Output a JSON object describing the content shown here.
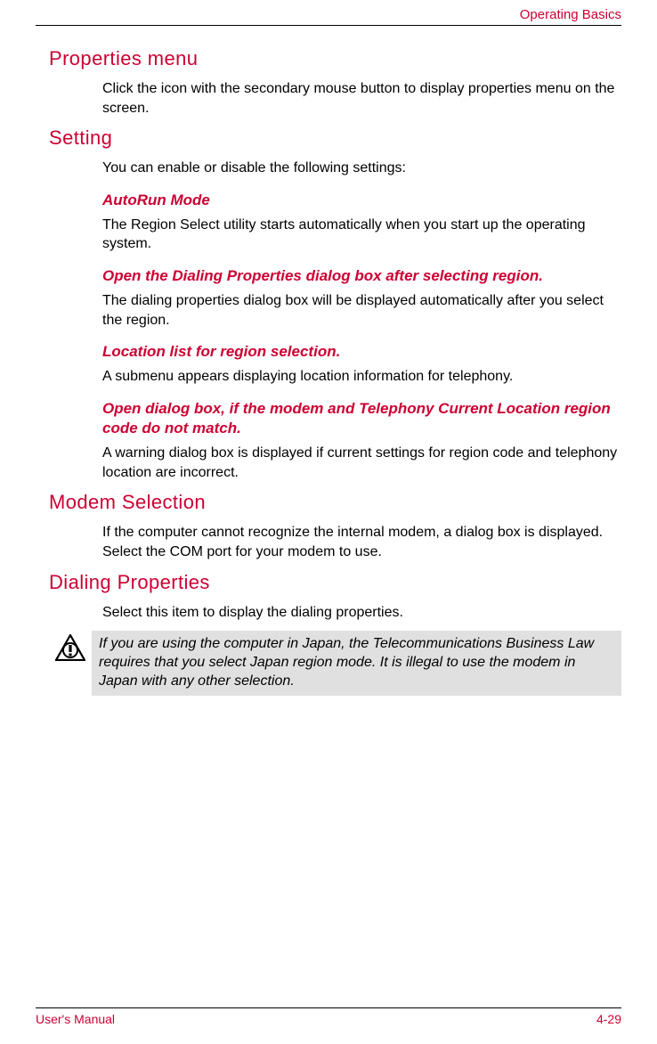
{
  "header": {
    "chapter": "Operating Basics"
  },
  "sections": {
    "properties_menu": {
      "title": "Properties menu",
      "body": "Click the icon with the secondary mouse button to display properties menu on the screen."
    },
    "setting": {
      "title": "Setting",
      "intro": "You can enable or disable the following settings:",
      "autorun": {
        "title": "AutoRun Mode",
        "body": "The Region Select utility starts automatically when you start up the operating system."
      },
      "open_dialing": {
        "title": "Open the Dialing Properties dialog box after selecting region.",
        "body": "The dialing properties dialog box will be displayed automatically after you select the region."
      },
      "location_list": {
        "title": "Location list for region selection.",
        "body": "A submenu appears displaying location information for telephony."
      },
      "open_dialog": {
        "title": "Open dialog box, if the modem and Telephony Current Location region code do not match.",
        "body": "A warning dialog box is displayed if current settings for region code and telephony location are incorrect."
      }
    },
    "modem_selection": {
      "title": "Modem Selection",
      "body": "If the computer cannot recognize the internal modem, a dialog box is displayed. Select the COM port for your modem to use."
    },
    "dialing_properties": {
      "title": "Dialing Properties",
      "body": "Select this item to display the dialing properties.",
      "warning": "If you are using the computer in Japan, the Telecommunications Business Law requires that you select Japan region mode. It is illegal to use the modem in Japan with any other selection."
    }
  },
  "footer": {
    "left": "User's Manual",
    "right": "4-29"
  }
}
